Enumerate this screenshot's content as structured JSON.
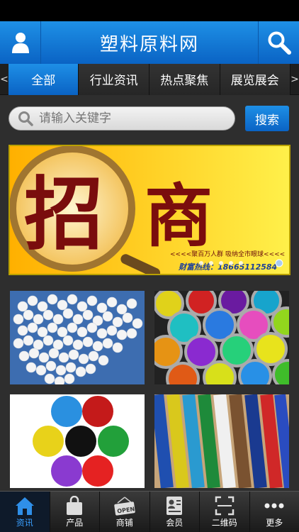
{
  "header": {
    "title": "塑料原料网",
    "user_icon": "user-icon",
    "search_icon": "search-icon"
  },
  "tabs": {
    "left_arrow": "<",
    "right_arrow": ">",
    "items": [
      {
        "label": "全部",
        "active": true
      },
      {
        "label": "行业资讯"
      },
      {
        "label": "热点聚焦"
      },
      {
        "label": "展览展会"
      }
    ]
  },
  "search": {
    "placeholder": "请输入关键字",
    "button_label": "搜索"
  },
  "banner": {
    "big1": "招",
    "big2": "商",
    "slogan": "<<<<聚百万人群  吸纳全市眼球<<<<",
    "hotline": "财富热线：18665112584"
  },
  "bottom_nav": [
    {
      "label": "资讯",
      "icon": "home-icon",
      "active": true
    },
    {
      "label": "产品",
      "icon": "shopping-bag-icon"
    },
    {
      "label": "商铺",
      "icon": "open-sign-icon"
    },
    {
      "label": "会员",
      "icon": "member-card-icon"
    },
    {
      "label": "二维码",
      "icon": "qr-scan-icon"
    },
    {
      "label": "更多",
      "icon": "more-dots-icon"
    }
  ],
  "colors": {
    "brand_blue": "#0a63c4",
    "background": "#2e2e2e"
  }
}
